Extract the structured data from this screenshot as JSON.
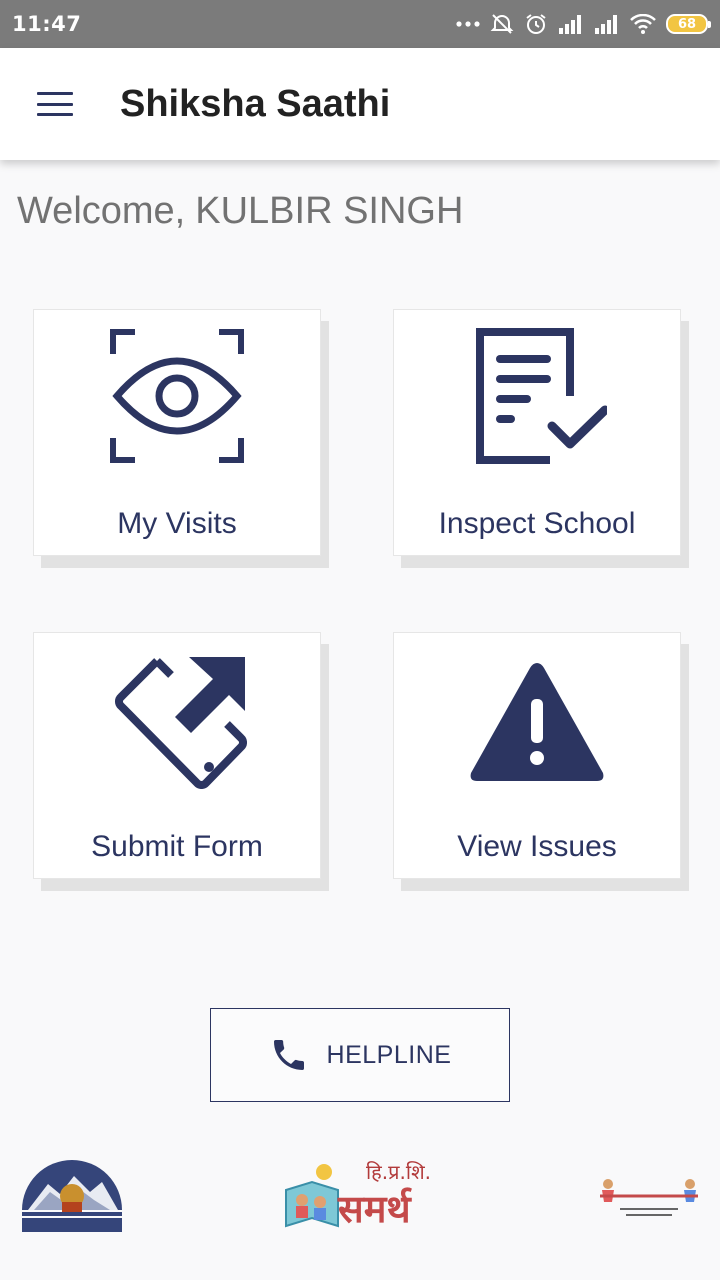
{
  "status_bar": {
    "time": "11:47",
    "battery": "68",
    "icons": [
      "more-dots-icon",
      "alarm-off-icon",
      "alarm-icon",
      "signal-icon",
      "signal-icon",
      "wifi-icon",
      "battery-icon"
    ]
  },
  "app_bar": {
    "title": "Shiksha Saathi",
    "menu_icon": "menu-icon"
  },
  "welcome": {
    "prefix": "Welcome,",
    "name": "KULBIR SINGH"
  },
  "tiles": [
    {
      "label": "My Visits",
      "icon": "eye-scan-icon"
    },
    {
      "label": "Inspect School",
      "icon": "document-check-icon"
    },
    {
      "label": "Submit Form",
      "icon": "phone-upload-icon"
    },
    {
      "label": "View Issues",
      "icon": "warning-icon"
    }
  ],
  "helpline": {
    "label": "HELPLINE",
    "icon": "phone-icon"
  },
  "logos": {
    "left": "Himachal Pradesh Government emblem",
    "center_top": "हि.प्र.शि.",
    "center_main": "समर्थ",
    "right": "शिक्षा का अधिकार"
  },
  "colors": {
    "primary": "#2c3561",
    "status_bar": "#7b7b7b",
    "background": "#f9f9fa"
  }
}
